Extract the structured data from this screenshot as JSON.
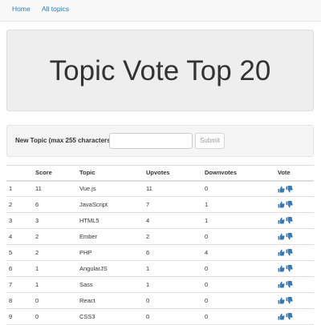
{
  "nav": {
    "home": "Home",
    "all_topics": "All topics"
  },
  "jumbotron": {
    "title": "Topic Vote Top 20"
  },
  "form": {
    "label": "New Topic (max 255 characters):",
    "input_value": "",
    "submit_label": "Submit"
  },
  "table": {
    "headers": [
      "",
      "Score",
      "Topic",
      "Upvotes",
      "Downvotes",
      "Vote"
    ],
    "rows": [
      {
        "rank": "1",
        "score": "11",
        "topic": "Vue.js",
        "upvotes": "11",
        "downvotes": "0"
      },
      {
        "rank": "2",
        "score": "6",
        "topic": "JavaScript",
        "upvotes": "7",
        "downvotes": "1"
      },
      {
        "rank": "3",
        "score": "3",
        "topic": "HTML5",
        "upvotes": "4",
        "downvotes": "1"
      },
      {
        "rank": "4",
        "score": "2",
        "topic": "Ember",
        "upvotes": "2",
        "downvotes": "0"
      },
      {
        "rank": "5",
        "score": "2",
        "topic": "PHP",
        "upvotes": "6",
        "downvotes": "4"
      },
      {
        "rank": "6",
        "score": "1",
        "topic": "AngularJS",
        "upvotes": "1",
        "downvotes": "0"
      },
      {
        "rank": "7",
        "score": "1",
        "topic": "Sass",
        "upvotes": "1",
        "downvotes": "0"
      },
      {
        "rank": "8",
        "score": "0",
        "topic": "React",
        "upvotes": "0",
        "downvotes": "0"
      },
      {
        "rank": "9",
        "score": "0",
        "topic": "CSS3",
        "upvotes": "0",
        "downvotes": "0"
      }
    ]
  },
  "icons": {
    "upvote": "thumbs-up-icon",
    "downvote": "thumbs-down-icon"
  },
  "colors": {
    "link": "#337ab7",
    "jumbotron_bg": "#eeeeee",
    "well_bg": "#f5f5f5",
    "navbar_bg": "#f8f8f8",
    "border": "#dddddd"
  }
}
